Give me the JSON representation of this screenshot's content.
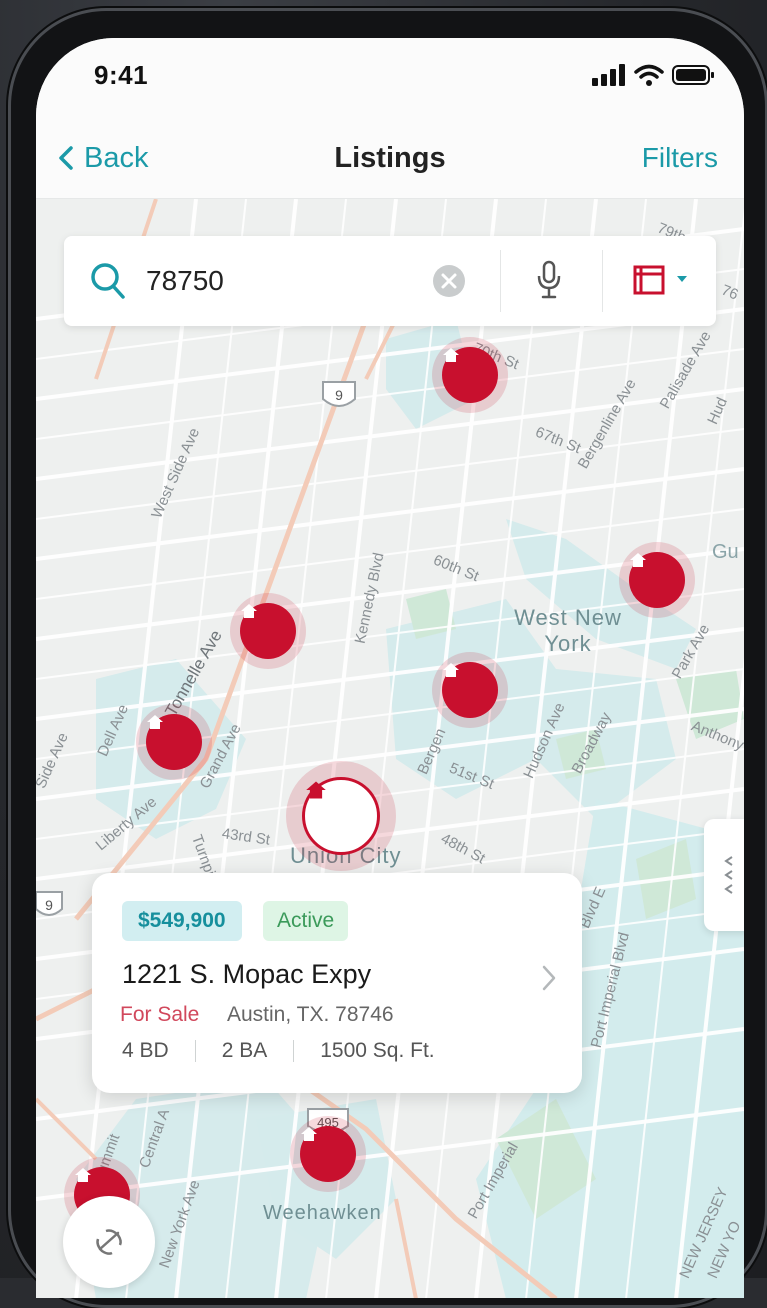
{
  "status_bar": {
    "time": "9:41"
  },
  "nav": {
    "back_label": "Back",
    "title": "Listings",
    "filters_label": "Filters"
  },
  "search": {
    "value": "78750"
  },
  "map": {
    "streets": [
      "79th",
      "70th St",
      "67th St",
      "Bergenline Ave",
      "Palisade Ave",
      "West Side Ave",
      "Tonnelle Ave",
      "Kennedy Blvd",
      "60th St",
      "51st St",
      "Dell Ave",
      "Grand Ave",
      "Liberty Ave",
      "Turnpike",
      "43rd St",
      "48th St",
      "Hudson Ave",
      "Broadway",
      "Park Ave",
      "Anthony",
      "Bergen",
      "Side Ave",
      "Blvd E",
      "Port Imperial Blvd",
      "Summit",
      "Central A",
      "New York Ave",
      "Port Imperial",
      "NEW JERSEY",
      "NEW YO",
      "Hud",
      "Gu",
      "76"
    ],
    "places": [
      "West New York",
      "Union City",
      "Weehawken"
    ],
    "route_shields": [
      "9",
      "495"
    ]
  },
  "selected_listing": {
    "price": "$549,900",
    "status": "Active",
    "address": "1221 S. Mopac Expy",
    "sale_type": "For Sale",
    "city": "Austin, TX. 78746",
    "beds": "4 BD",
    "baths": "2 BA",
    "sqft": "1500 Sq. Ft."
  },
  "colors": {
    "accent": "#1b9aa8",
    "pin": "#c8102e",
    "price_bg": "#d2eef1",
    "active_bg": "#def5e5"
  },
  "icons": [
    "back-chevron-icon",
    "search-icon",
    "clear-icon",
    "microphone-icon",
    "map-layers-icon",
    "home-icon",
    "chevron-right-icon",
    "locate-icon"
  ]
}
